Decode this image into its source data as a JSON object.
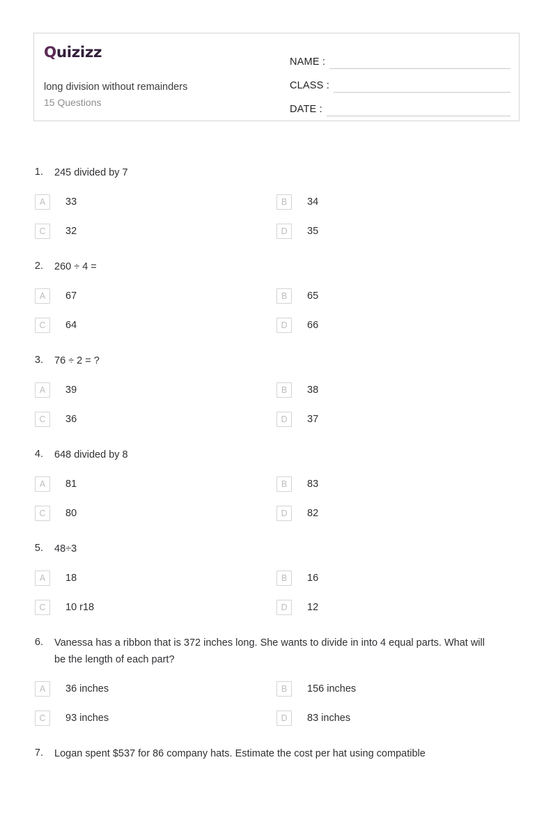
{
  "header": {
    "logo_text": "Quizizz",
    "logo_q": "Q",
    "logo_rest": "uizizz",
    "logo_color": "#32203a",
    "title": "long division without remainders",
    "question_count": "15 Questions",
    "fields": [
      {
        "label": "NAME :",
        "value": ""
      },
      {
        "label": "CLASS :",
        "value": ""
      },
      {
        "label": "DATE  :",
        "value": ""
      }
    ]
  },
  "questions": [
    {
      "number": "1.",
      "text": "245 divided by 7",
      "options": [
        {
          "letter": "A",
          "text": "33"
        },
        {
          "letter": "B",
          "text": "34"
        },
        {
          "letter": "C",
          "text": "32"
        },
        {
          "letter": "D",
          "text": "35"
        }
      ]
    },
    {
      "number": "2.",
      "text": "260 ÷ 4 =",
      "options": [
        {
          "letter": "A",
          "text": "67"
        },
        {
          "letter": "B",
          "text": "65"
        },
        {
          "letter": "C",
          "text": "64"
        },
        {
          "letter": "D",
          "text": "66"
        }
      ]
    },
    {
      "number": "3.",
      "text": "76 ÷ 2 = ?",
      "options": [
        {
          "letter": "A",
          "text": "39"
        },
        {
          "letter": "B",
          "text": "38"
        },
        {
          "letter": "C",
          "text": "36"
        },
        {
          "letter": "D",
          "text": "37"
        }
      ]
    },
    {
      "number": "4.",
      "text": "648 divided by 8",
      "options": [
        {
          "letter": "A",
          "text": "81"
        },
        {
          "letter": "B",
          "text": "83"
        },
        {
          "letter": "C",
          "text": "80"
        },
        {
          "letter": "D",
          "text": "82"
        }
      ]
    },
    {
      "number": "5.",
      "text": "48÷3",
      "options": [
        {
          "letter": "A",
          "text": "18"
        },
        {
          "letter": "B",
          "text": "16"
        },
        {
          "letter": "C",
          "text": "10 r18"
        },
        {
          "letter": "D",
          "text": "12"
        }
      ]
    },
    {
      "number": "6.",
      "text": "Vanessa has a ribbon that is 372 inches long. She wants to divide in into 4 equal parts. What will be the length of each part?",
      "options": [
        {
          "letter": "A",
          "text": "36 inches"
        },
        {
          "letter": "B",
          "text": "156 inches"
        },
        {
          "letter": "C",
          "text": "93 inches"
        },
        {
          "letter": "D",
          "text": "83 inches"
        }
      ]
    },
    {
      "number": "7.",
      "text": "Logan spent $537 for 86 company hats. Estimate the cost per hat using compatible",
      "options": []
    }
  ]
}
